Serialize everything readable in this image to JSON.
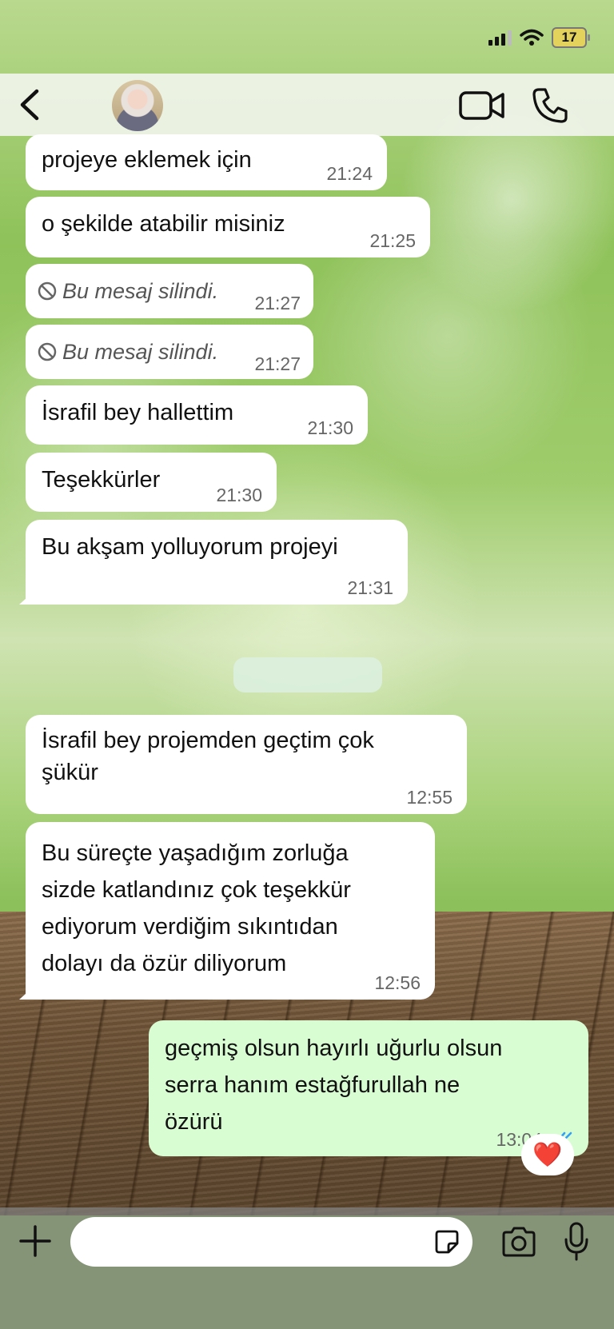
{
  "status_bar": {
    "battery": "17"
  },
  "header": {
    "back_icon": "chevron-left-icon",
    "video_icon": "video-camera-icon",
    "call_icon": "phone-icon"
  },
  "messages": [
    {
      "direction": "in",
      "text": "projeye eklemek için",
      "time": "21:24"
    },
    {
      "direction": "in",
      "text": "o şekilde atabilir misiniz",
      "time": "21:25"
    },
    {
      "direction": "in",
      "text": "Bu mesaj silindi.",
      "time": "21:27",
      "deleted": true
    },
    {
      "direction": "in",
      "text": "Bu mesaj silindi.",
      "time": "21:27",
      "deleted": true
    },
    {
      "direction": "in",
      "text": "İsrafil bey hallettim",
      "time": "21:30"
    },
    {
      "direction": "in",
      "text": "Teşekkürler",
      "time": "21:30"
    },
    {
      "direction": "in",
      "text": "Bu akşam yolluyorum projeyi",
      "time": "21:31"
    },
    {
      "direction": "in",
      "lines": [
        "İsrafil bey projemden geçtim çok",
        "şükür"
      ],
      "time": "12:55"
    },
    {
      "direction": "in",
      "lines": [
        "Bu süreçte yaşadığım zorluğa",
        "sizde katlandınız çok teşekkür",
        "ediyorum verdiğim sıkıntıdan",
        "dolayı da özür diliyorum"
      ],
      "time": "12:56"
    },
    {
      "direction": "out",
      "lines": [
        "geçmiş olsun hayırlı uğurlu olsun",
        "serra hanım estağfurullah ne",
        "özürü"
      ],
      "time": "13:04",
      "read": true,
      "reaction": "❤️"
    }
  ],
  "composer": {
    "placeholder": "",
    "plus_icon": "plus-icon",
    "sticker_icon": "sticker-icon",
    "camera_icon": "camera-icon",
    "mic_icon": "microphone-icon"
  },
  "colors": {
    "incoming": "#ffffff",
    "outgoing": "#d9fdd3",
    "read_ticks": "#34a0f5"
  }
}
